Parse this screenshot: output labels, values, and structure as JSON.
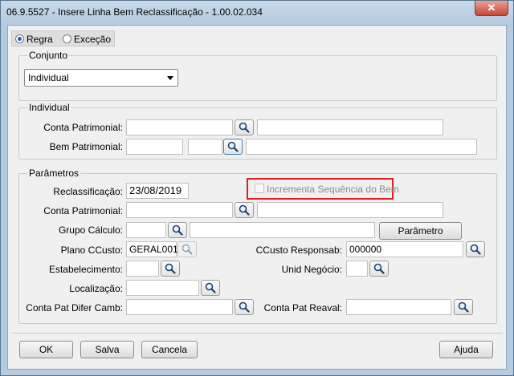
{
  "window": {
    "title": "06.9.5527 - Insere Linha Bem Reclassificação - 1.00.02.034",
    "close_glyph": "✕"
  },
  "mode": {
    "option_rule": "Regra",
    "option_exception": "Exceção",
    "selected": "Regra"
  },
  "conjunto": {
    "group_label": "Conjunto",
    "selected": "Individual"
  },
  "individual": {
    "group_label": "Individual",
    "conta_patrimonial_label": "Conta Patrimonial:",
    "conta_patrimonial_value": "",
    "conta_patrimonial_desc": "",
    "bem_patrimonial_label": "Bem Patrimonial:",
    "bem_patrimonial_value": "",
    "bem_patrimonial_seq": "",
    "bem_patrimonial_desc": ""
  },
  "parametros": {
    "group_label": "Parâmetros",
    "reclassificacao_label": "Reclassificação:",
    "reclassificacao_value": "23/08/2019",
    "incrementa_label": "Incrementa Sequência do Bem",
    "conta_patrimonial_label": "Conta Patrimonial:",
    "grupo_calculo_label": "Grupo Cálculo:",
    "parametro_button": "Parâmetro",
    "plano_ccusto_label": "Plano CCusto:",
    "plano_ccusto_value": "GERAL001",
    "ccusto_responsab_label": "CCusto Responsab:",
    "ccusto_responsab_value": "000000",
    "estabelecimento_label": "Estabelecimento:",
    "unid_negocio_label": "Unid Negócio:",
    "localizacao_label": "Localização:",
    "conta_pat_difer_camb_label": "Conta Pat Difer Camb:",
    "conta_pat_reaval_label": "Conta Pat Reaval:"
  },
  "buttons": {
    "ok": "OK",
    "salva": "Salva",
    "cancela": "Cancela",
    "ajuda": "Ajuda"
  },
  "colors": {
    "window_frame": "#b6cbe0",
    "client_bg": "#f0f0f0",
    "close_red": "#c7473a",
    "highlight": "#e02020"
  }
}
